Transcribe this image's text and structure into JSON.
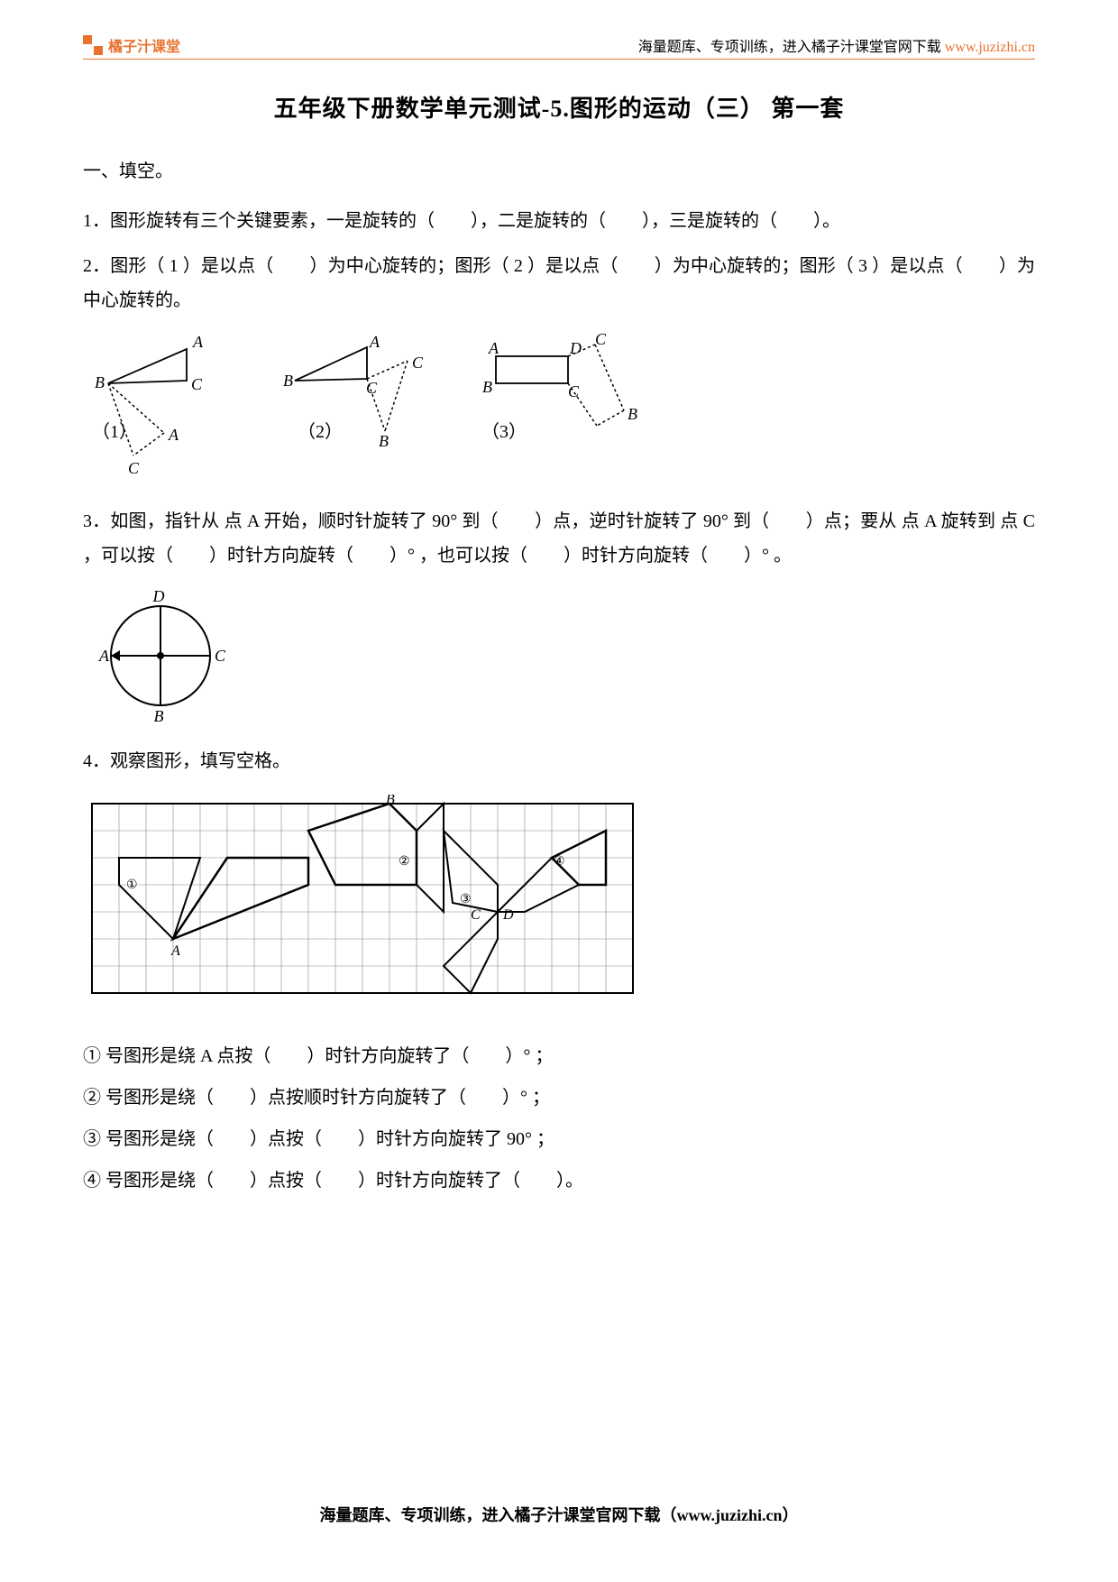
{
  "header": {
    "logo_text": "橘子汁课堂",
    "right_text_prefix": "海量题库、专项训练，进入橘子汁课堂官网下载 ",
    "url": "www.juzizhi.cn"
  },
  "title": "五年级下册数学单元测试-5.图形的运动（三）  第一套",
  "section1_heading": "一、填空。",
  "q1": "1．图形旋转有三个关键要素，一是旋转的（　　），二是旋转的（　　），三是旋转的（　　）。",
  "q2": "2．图形（ 1 ）是以点（　　）为中心旋转的；图形（ 2 ）是以点（　　）为中心旋转的；图形（ 3 ）是以点（　　）为中心旋转的。",
  "fig_labels": {
    "a": "A",
    "b": "B",
    "c": "C",
    "d": "D",
    "n1": "（1）",
    "n2": "（2）",
    "n3": "（3）"
  },
  "q3": "3．如图，指针从 点 A 开始，顺时针旋转了 90° 到（　　）点，逆时针旋转了 90° 到（　　）点；要从 点 A 旋转到 点 C ，可以按（　　）时针方向旋转（　　）° ，也可以按（　　）时针方向旋转（　　）° 。",
  "q4_heading": "4．观察图形，填写空格。",
  "q4_items": {
    "i1": "① 号图形是绕 A 点按（　　）时针方向旋转了（　　）° ；",
    "i2": "② 号图形是绕（　　）点按顺时针方向旋转了（　　）° ；",
    "i3": "③ 号图形是绕（　　）点按（　　）时针方向旋转了 90° ；",
    "i4": "④ 号图形是绕（　　）点按（　　）时针方向旋转了（　　）。"
  },
  "grid_labels": {
    "A": "A",
    "B": "B",
    "C": "C",
    "D": "D",
    "c1": "①",
    "c2": "②",
    "c3": "③",
    "c4": "④"
  },
  "footer": "海量题库、专项训练，进入橘子汁课堂官网下载（www.juzizhi.cn）"
}
